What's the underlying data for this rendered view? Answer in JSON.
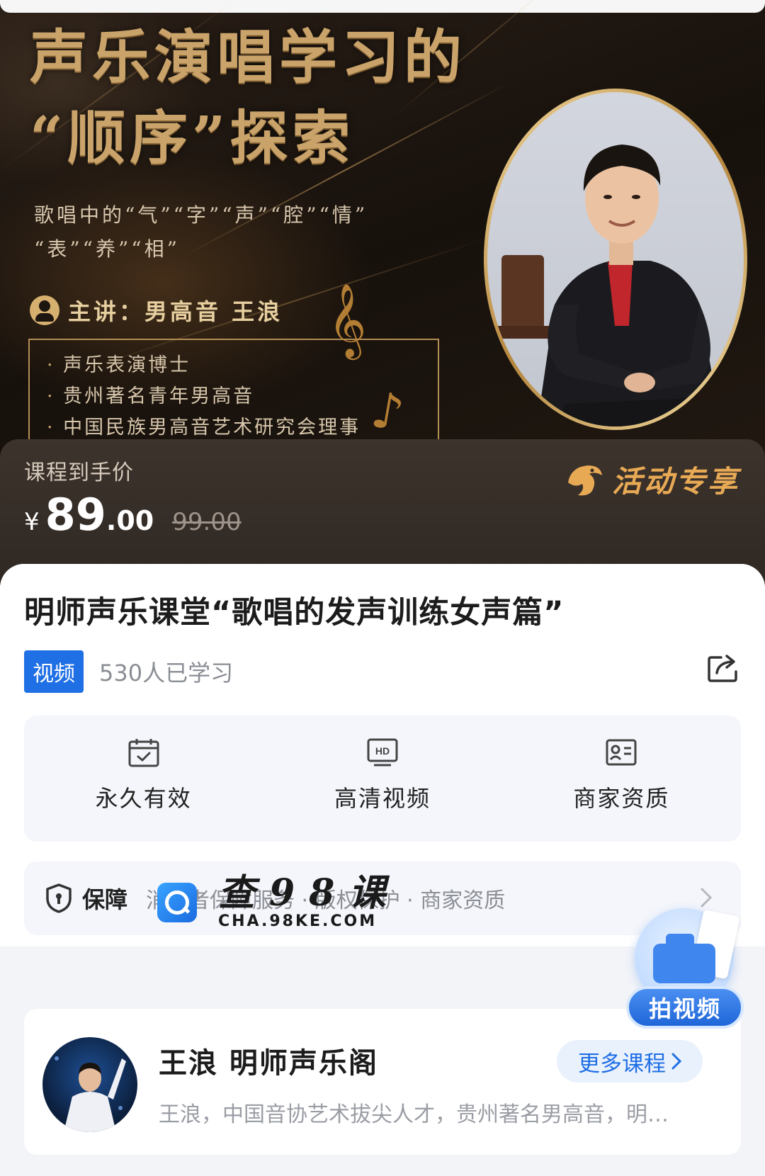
{
  "banner": {
    "title_line1": "声乐演唱学习的",
    "title_line2": "“顺序”探索",
    "subtitle_line1": "歌唱中的“气”“字”“声”“腔”“情”",
    "subtitle_line2": "“表”“养”“相”",
    "lecturer": "主讲：男高音 王浪",
    "credentials": [
      "声乐表演博士",
      "贵州著名青年男高音",
      "中国民族男高音艺术研究会理事"
    ],
    "icons": [
      "person-icon",
      "music-note-icon"
    ]
  },
  "price": {
    "label": "课程到手价",
    "currency": "¥",
    "amount_int": "89",
    "amount_dec": ".00",
    "original": "99.00",
    "activity": "活动专享"
  },
  "course": {
    "title": "明师声乐课堂“歌唱的发声训练女声篇”",
    "tag": "视频",
    "learners": "530人已学习"
  },
  "features": [
    {
      "label": "永久有效",
      "icon": "calendar-check-icon"
    },
    {
      "label": "高清视频",
      "icon": "hd-icon"
    },
    {
      "label": "商家资质",
      "icon": "id-card-icon"
    }
  ],
  "guarantee": {
    "title": "保障",
    "items": "消费者保障服务 · 版权保护 · 商家资质"
  },
  "watermark": {
    "main": "查98课",
    "sub": "CHA.98KE.COM"
  },
  "teacher": {
    "name": "王浪 明师声乐阁",
    "desc": "王浪，中国音协艺术拔尖人才，贵州著名男高音，明…",
    "more": "更多课程"
  },
  "float_button": {
    "label": "拍视频"
  },
  "colors": {
    "accent_blue": "#1f6fe5",
    "gold": "#c9a36a",
    "activity_orange": "#e8a955"
  }
}
